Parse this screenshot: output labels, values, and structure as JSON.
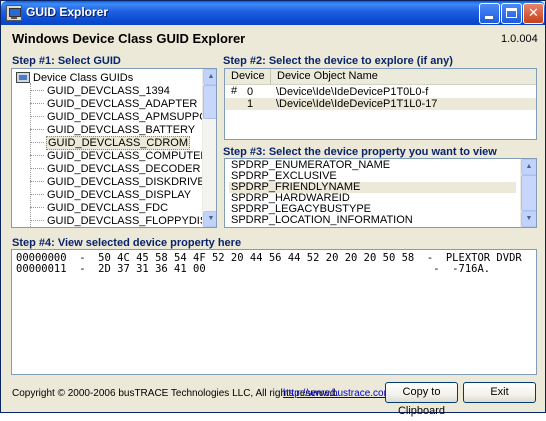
{
  "window": {
    "title": "GUID Explorer",
    "heading": "Windows Device Class GUID Explorer",
    "version": "1.0.004"
  },
  "step1": {
    "label": "Step #1:  Select GUID",
    "root": "Device Class GUIDs",
    "items": [
      "GUID_DEVCLASS_1394",
      "GUID_DEVCLASS_ADAPTER",
      "GUID_DEVCLASS_APMSUPPORT",
      "GUID_DEVCLASS_BATTERY",
      "GUID_DEVCLASS_CDROM",
      "GUID_DEVCLASS_COMPUTER",
      "GUID_DEVCLASS_DECODER",
      "GUID_DEVCLASS_DISKDRIVE",
      "GUID_DEVCLASS_DISPLAY",
      "GUID_DEVCLASS_FDC",
      "GUID_DEVCLASS_FLOPPYDISK"
    ],
    "selected_index": 4
  },
  "step2": {
    "label": "Step #2:  Select the device to explore (if any)",
    "columns": [
      "Device #",
      "Device Object Name"
    ],
    "rows": [
      {
        "num": "0",
        "name": "\\Device\\Ide\\IdeDeviceP1T0L0-f"
      },
      {
        "num": "1",
        "name": "\\Device\\Ide\\IdeDeviceP1T1L0-17"
      }
    ],
    "selected_index": 1
  },
  "step3": {
    "label": "Step #3:  Select the device property you want to view",
    "items": [
      "SPDRP_ENUMERATOR_NAME",
      "SPDRP_EXCLUSIVE",
      "SPDRP_FRIENDLYNAME",
      "SPDRP_HARDWAREID",
      "SPDRP_LEGACYBUSTYPE",
      "SPDRP_LOCATION_INFORMATION"
    ],
    "selected_index": 2
  },
  "step4": {
    "label": "Step #4:  View selected device property here",
    "lines": [
      "00000000  -  50 4C 45 58 54 4F 52 20 44 56 44 52 20 20 20 50 58  -  PLEXTOR DVDR   PX",
      "00000011  -  2D 37 31 36 41 00                                    -  -716A."
    ]
  },
  "footer": {
    "copyright": "Copyright © 2000-2006 busTRACE Technologies LLC,  All rights reserved.",
    "link": "http://www.bustrace.com",
    "copy_button": "Copy to Clipboard",
    "exit_button": "Exit"
  },
  "icons": {
    "app": "app-icon",
    "minimize": "minimize-icon",
    "maximize": "maximize-icon",
    "close": "close-icon",
    "computer": "computer-icon"
  },
  "colors": {
    "titlebar": "#0a46c4",
    "window_bg": "#ece9d8",
    "step_label": "#0a246a",
    "link": "#0000cc"
  }
}
